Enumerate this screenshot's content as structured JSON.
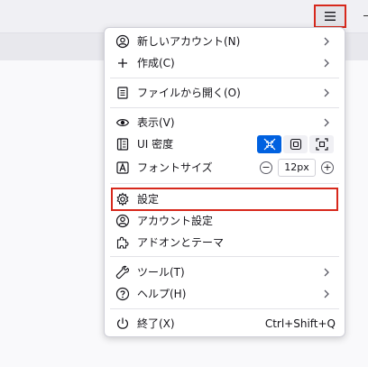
{
  "menu": {
    "items": [
      {
        "label": "新しいアカウント(N)",
        "icon": "account-add-icon",
        "submenu": true
      },
      {
        "label": "作成(C)",
        "icon": "plus-icon",
        "submenu": true
      },
      {
        "label": "ファイルから開く(O)",
        "icon": "file-open-icon",
        "submenu": true
      },
      {
        "label": "表示(V)",
        "icon": "eye-icon",
        "submenu": true
      },
      {
        "label": "UI 密度",
        "icon": "density-icon",
        "submenu": false
      },
      {
        "label": "フォントサイズ",
        "icon": "font-size-icon",
        "submenu": false
      },
      {
        "label": "設定",
        "icon": "gear-icon",
        "submenu": false
      },
      {
        "label": "アカウント設定",
        "icon": "account-settings-icon",
        "submenu": false
      },
      {
        "label": "アドオンとテーマ",
        "icon": "puzzle-icon",
        "submenu": false
      },
      {
        "label": "ツール(T)",
        "icon": "wrench-icon",
        "submenu": true
      },
      {
        "label": "ヘルプ(H)",
        "icon": "help-icon",
        "submenu": true
      },
      {
        "label": "終了(X)",
        "icon": "power-icon",
        "submenu": false,
        "shortcut": "Ctrl+Shift+Q"
      }
    ],
    "density_active": "compact",
    "font_size_value": "12px",
    "font_decrease": "−",
    "font_increase": "+"
  },
  "colors": {
    "accent": "#0061e0",
    "highlight": "#d7281c"
  }
}
